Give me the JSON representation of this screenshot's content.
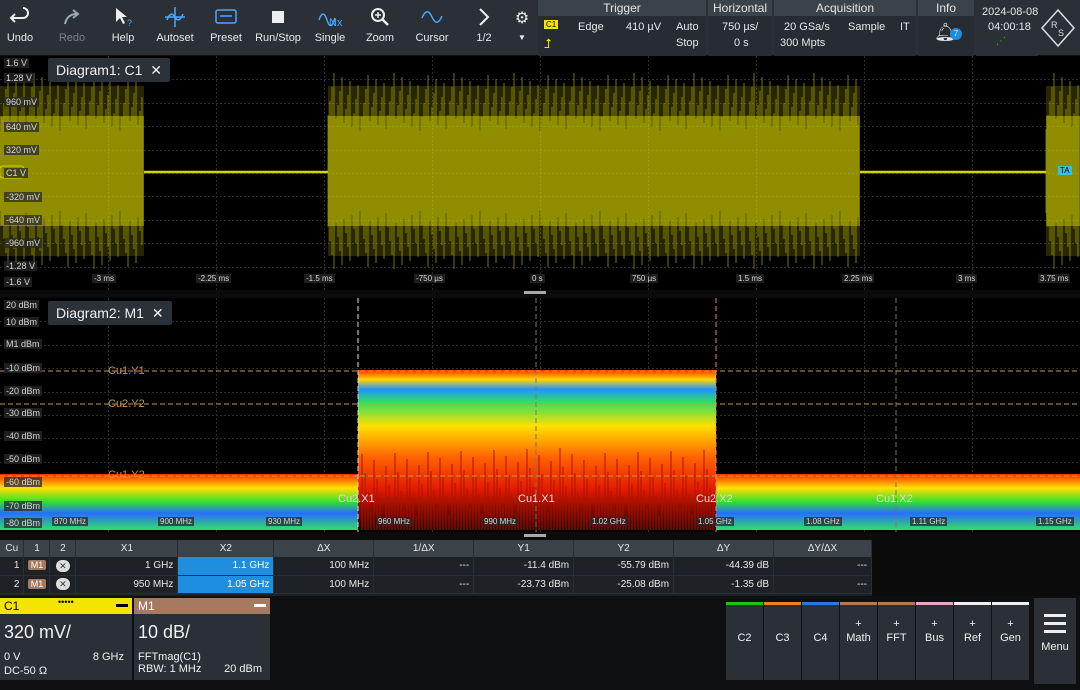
{
  "toolbar": {
    "buttons": [
      {
        "label": "Undo",
        "icon": "undo-icon"
      },
      {
        "label": "Redo",
        "icon": "redo-icon"
      },
      {
        "label": "Help",
        "icon": "help-cursor-icon"
      },
      {
        "label": "Autoset",
        "icon": "autoset-icon"
      },
      {
        "label": "Preset",
        "icon": "preset-icon"
      },
      {
        "label": "Run/Stop",
        "icon": "stop-icon"
      },
      {
        "label": "Single",
        "icon": "single-nx-icon"
      },
      {
        "label": "Zoom",
        "icon": "zoom-icon"
      },
      {
        "label": "Cursor",
        "icon": "cursor-wave-icon"
      },
      {
        "label": "1/2",
        "icon": "chevron-right-icon"
      }
    ],
    "trigger": {
      "title": "Trigger",
      "source": "C1",
      "type": "Edge",
      "level": "410 µV",
      "mode1": "Auto",
      "mode2": "Stop"
    },
    "horizontal": {
      "title": "Horizontal",
      "scale": "750 µs/",
      "position": "0 s"
    },
    "acquisition": {
      "title": "Acquisition",
      "rate": "20 GSa/s",
      "mode": "Sample",
      "it": "IT",
      "points": "300 Mpts"
    },
    "info": {
      "title": "Info",
      "count": "7"
    },
    "datetime": {
      "date": "2024-08-08",
      "time": "04:00:18"
    }
  },
  "diagram1": {
    "title": "Diagram1: C1",
    "close": "✕",
    "ylabels": [
      "1.6 V",
      "1.28 V",
      "960 mV",
      "640 mV",
      "320 mV",
      "C1 V",
      "-320 mV",
      "-640 mV",
      "-960 mV",
      "-1.28 V",
      "-1.6 V"
    ],
    "xlabels": [
      "-3 ms",
      "-2.25 ms",
      "-1.5 ms",
      "-750 µs",
      "0 s",
      "750 µs",
      "1.5 ms",
      "2.25 ms",
      "3 ms",
      "3.75 ms"
    ],
    "color": "#d8d200"
  },
  "diagram2": {
    "title": "Diagram2: M1",
    "close": "✕",
    "ylabels": [
      "20 dBm",
      "10 dBm",
      "M1 dBm",
      "-10 dBm",
      "-20 dBm",
      "-30 dBm",
      "-40 dBm",
      "-50 dBm",
      "-60 dBm",
      "-70 dBm",
      "-80 dBm"
    ],
    "xlabels": [
      "870 MHz",
      "900 MHz",
      "930 MHz",
      "960 MHz",
      "990 MHz",
      "1.02 GHz",
      "1.05 GHz",
      "1.08 GHz",
      "1.11 GHz",
      "1.15 GHz"
    ],
    "cursor_labels": {
      "y1_upper": "Cu1.Y1",
      "y2": "Cu2.Y2",
      "y1_lower": "Cu1.Y2",
      "x1a": "Cu2.X1",
      "x1b": "Cu1.X1",
      "x2a": "Cu2.X2",
      "x2b": "Cu1.X2"
    }
  },
  "cursor_table": {
    "headers": [
      "Cu",
      "1",
      "2",
      "X1",
      "X2",
      "ΔX",
      "1/ΔX",
      "Y1",
      "Y2",
      "ΔY",
      "ΔY/ΔX"
    ],
    "rows": [
      {
        "cu": "1",
        "src": "M1",
        "x1": "1 GHz",
        "x2": "1.1 GHz",
        "dx": "100 MHz",
        "inv": "---",
        "y1": "-11.4 dBm",
        "y2": "-55.79 dBm",
        "dy": "-44.39 dB",
        "dydx": "---"
      },
      {
        "cu": "2",
        "src": "M1",
        "x1": "950 MHz",
        "x2": "1.05 GHz",
        "dx": "100 MHz",
        "inv": "---",
        "y1": "-23.73 dBm",
        "y2": "-25.08 dBm",
        "dy": "-1.35 dB",
        "dydx": "---"
      }
    ]
  },
  "channels": {
    "c1": {
      "name": "C1",
      "scale": "320 mV/",
      "offset": "0 V",
      "bw": "8 GHz",
      "coupling": "DC-50 Ω",
      "color": "#f2e600"
    },
    "m1": {
      "name": "M1",
      "scale": "10 dB/",
      "func": "FFTmag(C1)",
      "rbw": "RBW: 1 MHz",
      "ref": "20 dBm",
      "color": "#a57a60"
    }
  },
  "side_buttons": [
    {
      "label": "C2",
      "color": "#19c419"
    },
    {
      "label": "C3",
      "color": "#f07d1e"
    },
    {
      "label": "C4",
      "color": "#2a78e6"
    },
    {
      "label": "Math",
      "color": "#b47a55"
    },
    {
      "label": "FFT",
      "color": "#b47a55"
    },
    {
      "label": "Bus",
      "color": "#e6a6c8"
    },
    {
      "label": "Ref",
      "color": "#f0f0f0"
    },
    {
      "label": "Gen",
      "color": "#f0f0f0"
    }
  ],
  "menu": {
    "label": "Menu"
  }
}
